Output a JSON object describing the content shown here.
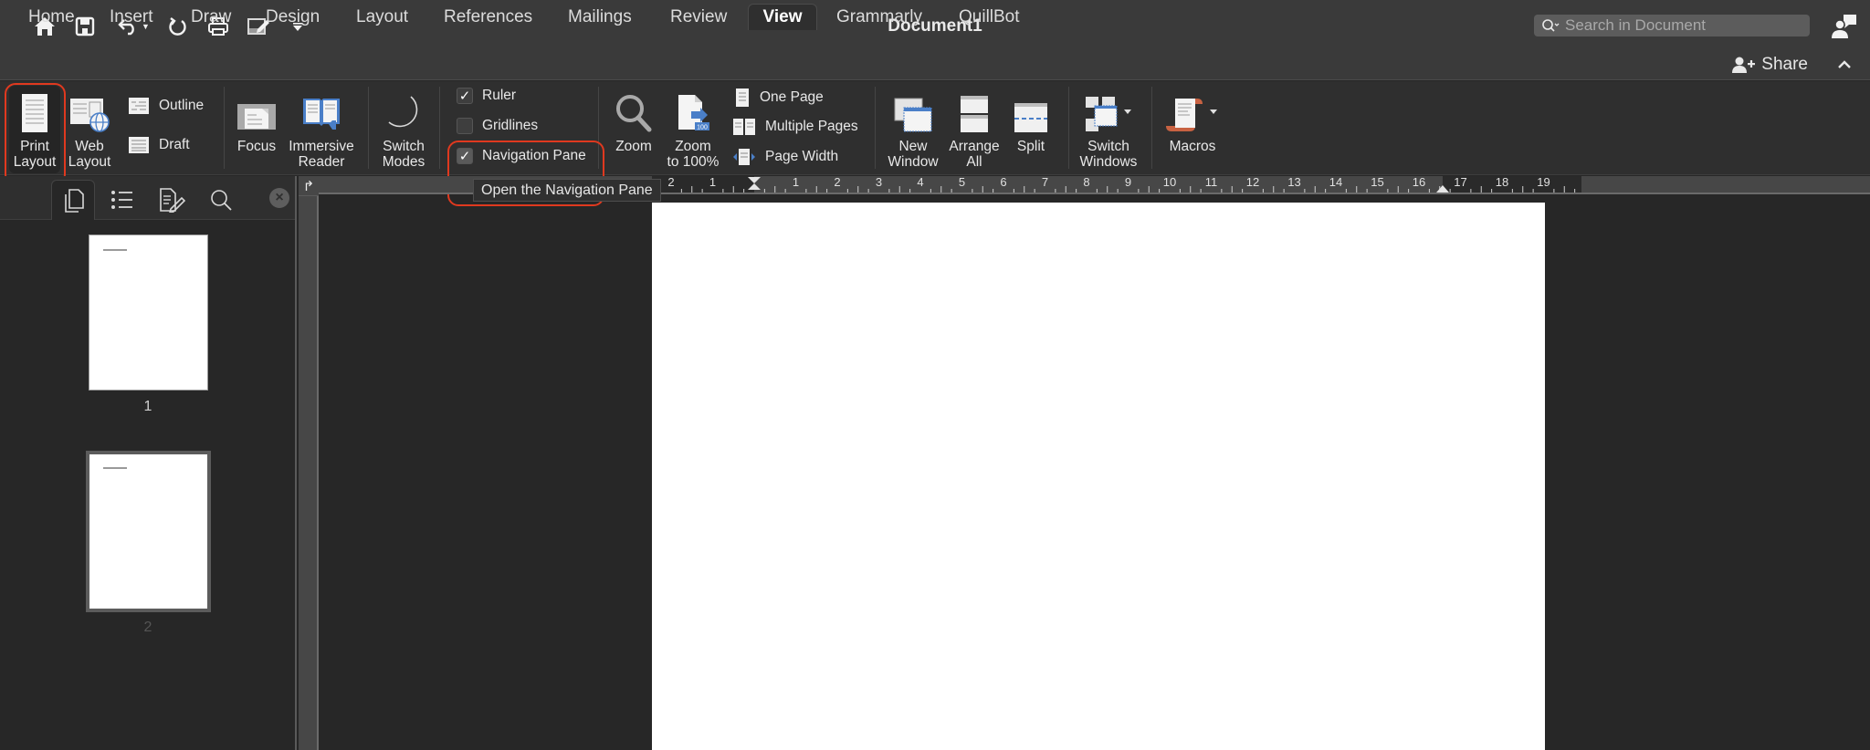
{
  "titlebar": {
    "title": "Document1",
    "search_placeholder": "Search in Document",
    "quick_access": [
      "home-icon",
      "save-icon",
      "undo-icon",
      "redo-icon",
      "print-icon",
      "edit-document-icon",
      "customize-toolbar-icon"
    ]
  },
  "tabs": [
    {
      "label": "Home",
      "active": false
    },
    {
      "label": "Insert",
      "active": false
    },
    {
      "label": "Draw",
      "active": false
    },
    {
      "label": "Design",
      "active": false
    },
    {
      "label": "Layout",
      "active": false
    },
    {
      "label": "References",
      "active": false
    },
    {
      "label": "Mailings",
      "active": false
    },
    {
      "label": "Review",
      "active": false
    },
    {
      "label": "View",
      "active": true
    },
    {
      "label": "Grammarly",
      "active": false
    },
    {
      "label": "QuillBot",
      "active": false
    }
  ],
  "share_label": "Share",
  "ribbon": {
    "views": {
      "print_layout": [
        "Print",
        "Layout"
      ],
      "web_layout": [
        "Web",
        "Layout"
      ],
      "outline": "Outline",
      "draft": "Draft"
    },
    "immersive": {
      "focus": "Focus",
      "immersive_reader": [
        "Immersive",
        "Reader"
      ]
    },
    "switch_modes": [
      "Switch",
      "Modes"
    ],
    "show": {
      "ruler": {
        "label": "Ruler",
        "checked": true
      },
      "gridlines": {
        "label": "Gridlines",
        "checked": false
      },
      "navigation_pane": {
        "label": "Navigation Pane",
        "checked": true
      }
    },
    "zoom": {
      "zoom": "Zoom",
      "zoom100": [
        "Zoom",
        "to 100%"
      ],
      "one_page": "One Page",
      "multiple_pages": "Multiple Pages",
      "page_width": "Page Width"
    },
    "window": {
      "new_window": [
        "New",
        "Window"
      ],
      "arrange_all": [
        "Arrange",
        "All"
      ],
      "split": "Split",
      "switch_windows": [
        "Switch",
        "Windows"
      ]
    },
    "macros": "Macros"
  },
  "tooltip": "Open the Navigation Pane",
  "highlight_color": "#e0391f",
  "nav_pane": {
    "tabs": [
      "thumbnails-icon",
      "headings-icon",
      "results-icon",
      "search-icon"
    ],
    "pages": [
      {
        "number": "1",
        "selected": false
      },
      {
        "number": "2",
        "selected": true
      }
    ]
  },
  "ruler": {
    "left_labels": [
      "2",
      "1"
    ],
    "labels": [
      "1",
      "2",
      "3",
      "4",
      "5",
      "6",
      "7",
      "8",
      "9",
      "10",
      "11",
      "12",
      "13",
      "14",
      "15",
      "16",
      "17",
      "18",
      "19"
    ]
  }
}
